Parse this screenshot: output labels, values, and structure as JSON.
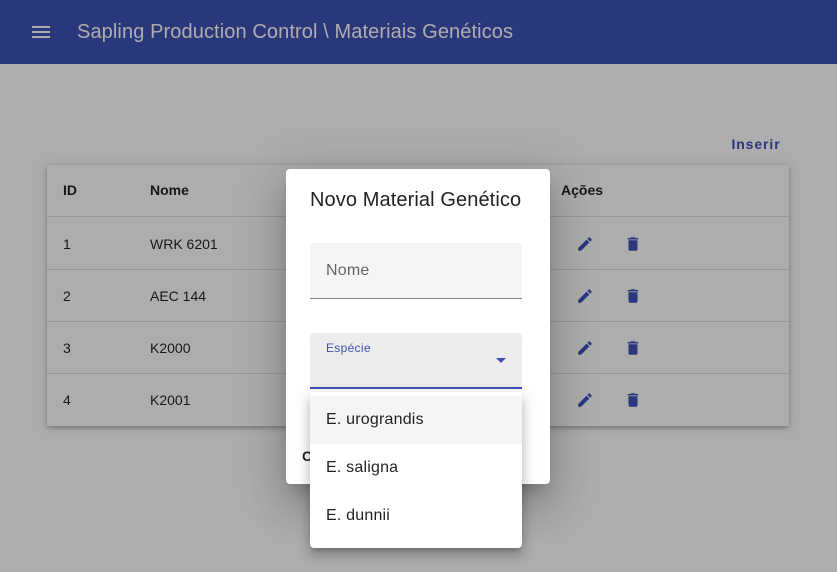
{
  "app_bar": {
    "title": "Sapling Production Control \\ Materiais Genéticos",
    "menu_icon": "menu-icon",
    "color": "#3f51b5"
  },
  "page": {
    "insert_label": "Inserir"
  },
  "table": {
    "columns": [
      "ID",
      "Nome",
      "Ações"
    ],
    "rows": [
      {
        "id": "1",
        "nome": "WRK 6201"
      },
      {
        "id": "2",
        "nome": "AEC 144"
      },
      {
        "id": "3",
        "nome": "K2000"
      },
      {
        "id": "4",
        "nome": "K2001"
      }
    ],
    "edit_icon": "pencil-icon",
    "delete_icon": "trash-icon"
  },
  "dialog": {
    "title": "Novo Material Genético",
    "nome_placeholder": "Nome",
    "especie_label": "Espécie",
    "especie_value": "",
    "action_label_visible": "C"
  },
  "dropdown": {
    "options": [
      "E. urograndis",
      "E. saligna",
      "E. dunnii"
    ],
    "highlighted": "E. urograndis"
  }
}
